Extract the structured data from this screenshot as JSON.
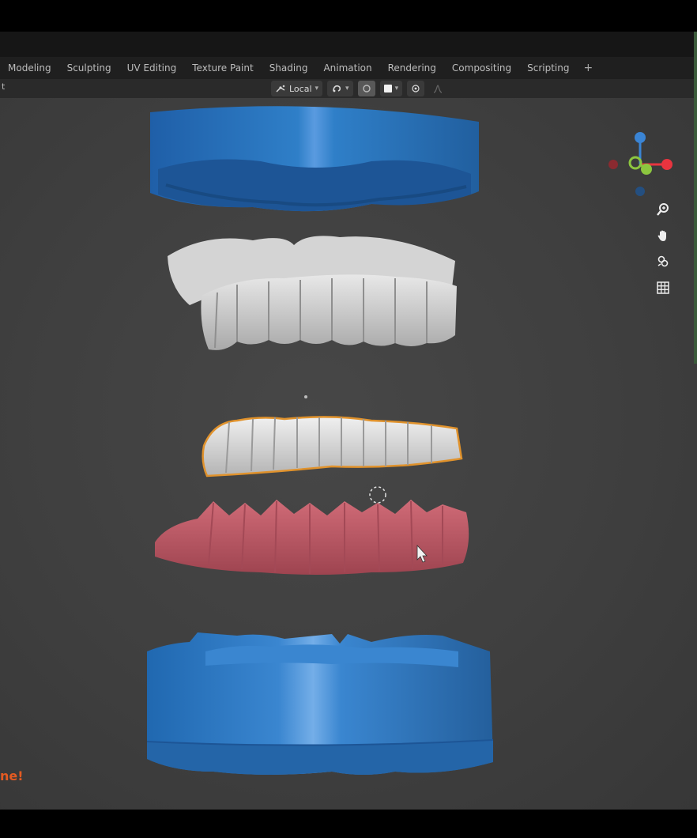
{
  "workspace_tabs": [
    {
      "label": "Modeling"
    },
    {
      "label": "Sculpting"
    },
    {
      "label": "UV Editing"
    },
    {
      "label": "Texture Paint"
    },
    {
      "label": "Shading"
    },
    {
      "label": "Animation"
    },
    {
      "label": "Rendering"
    },
    {
      "label": "Compositing"
    },
    {
      "label": "Scripting"
    }
  ],
  "add_tab_label": "+",
  "header": {
    "left_fragment": "t",
    "transform_orientation": "Local"
  },
  "footer_note": "ne!",
  "colors": {
    "mould_blue": "#2f7fc8",
    "teeth_white": "#d9d9d9",
    "gum_pink": "#c05764",
    "selection_orange": "#e0922c",
    "axis_x": "#e8343f",
    "axis_y": "#8cc63f",
    "axis_z": "#3a84d4"
  },
  "icons": [
    "transform-orientation-icon",
    "snap-icon",
    "proportional-icon",
    "zoom-icon",
    "hand-pan-icon",
    "camera-icon",
    "grid-icon",
    "3d-cursor-icon"
  ]
}
